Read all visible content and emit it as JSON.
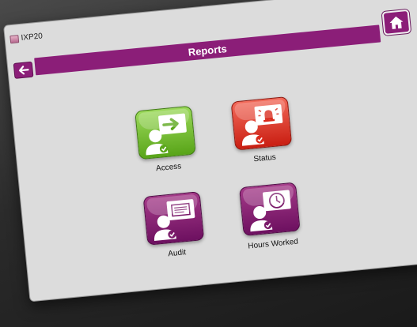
{
  "window": {
    "title": "IXP20",
    "minimize_label": "▭",
    "maximize_label": "▢",
    "close_label": "✕"
  },
  "header": {
    "title": "Reports"
  },
  "tiles": [
    {
      "label": "Access",
      "icon": "access-icon",
      "color": "#6cba2a"
    },
    {
      "label": "Status",
      "icon": "status-alarm-icon",
      "color": "#e0372a"
    },
    {
      "label": "Audit",
      "icon": "audit-document-icon",
      "color": "#8b1e78"
    },
    {
      "label": "Hours Worked",
      "icon": "hours-clock-icon",
      "color": "#8b1e78"
    }
  ],
  "colors": {
    "accent": "#8b1e78",
    "window_bg": "#dcdcdc"
  }
}
